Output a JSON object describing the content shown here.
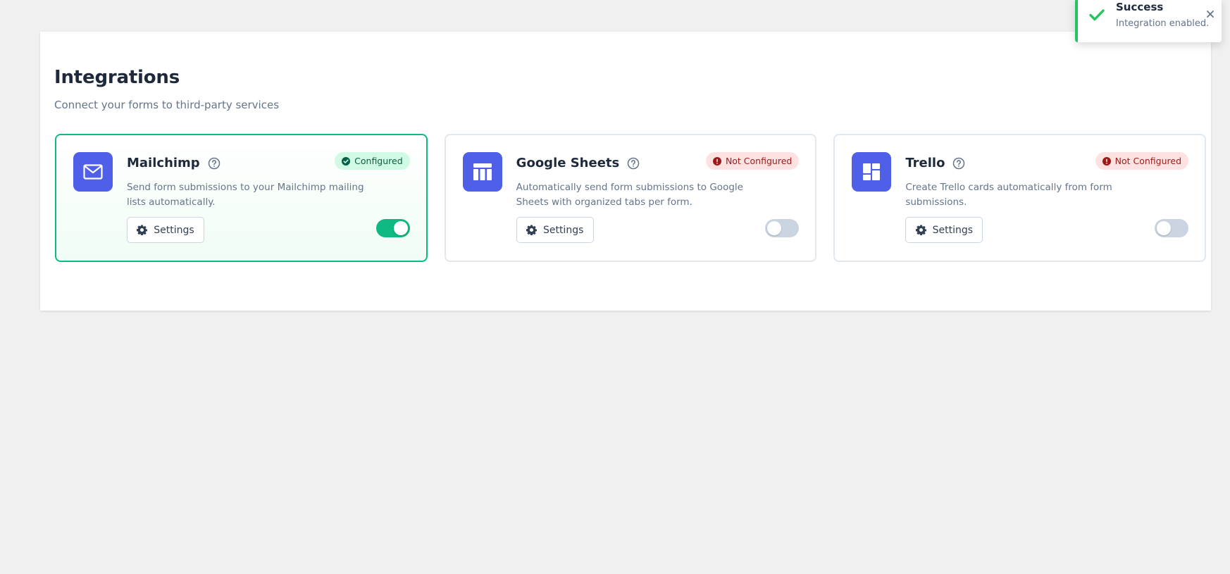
{
  "page": {
    "title": "Integrations",
    "subtitle": "Connect your forms to third-party services"
  },
  "colors": {
    "accent": "#4f5fe8",
    "success": "#10b981",
    "danger": "#991b1b"
  },
  "integrations": [
    {
      "name": "Mailchimp",
      "icon": "mail-icon",
      "status": "Configured",
      "status_type": "configured",
      "description": "Send form submissions to your Mailchimp mailing lists automatically.",
      "settings_label": "Settings",
      "enabled": true
    },
    {
      "name": "Google Sheets",
      "icon": "table-icon",
      "status": "Not Configured",
      "status_type": "not-configured",
      "description": "Automatically send form submissions to Google Sheets with organized tabs per form.",
      "settings_label": "Settings",
      "enabled": false
    },
    {
      "name": "Trello",
      "icon": "board-icon",
      "status": "Not Configured",
      "status_type": "not-configured",
      "description": "Create Trello cards automatically from form submissions.",
      "settings_label": "Settings",
      "enabled": false
    }
  ],
  "toast": {
    "title": "Success",
    "message": "Integration enabled.",
    "icon": "check-icon"
  }
}
